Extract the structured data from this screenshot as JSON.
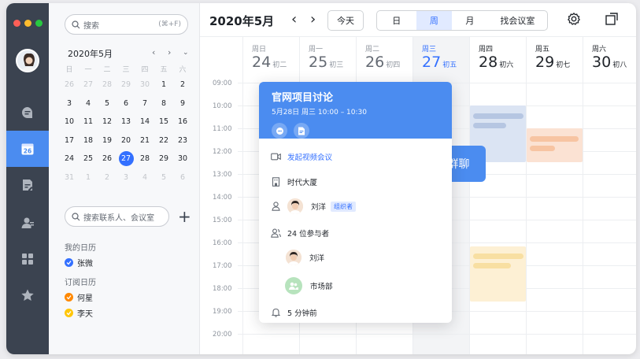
{
  "colors": {
    "accent": "#3370ff",
    "nav_bg": "#3b4350",
    "card_header": "#4b8cf0",
    "event_blue": "#dbe4f3",
    "event_orange": "#fbe2d3",
    "event_yellow": "#fdf0d4",
    "calendar_blue": "#3370ff",
    "calendar_orange": "#ff8800",
    "calendar_yellow": "#ffc60a"
  },
  "nav": {
    "items": [
      "chat-icon",
      "calendar-icon",
      "docs-icon",
      "contacts-icon",
      "apps-icon",
      "favorites-icon"
    ],
    "calendar_badge": "26"
  },
  "sidebar": {
    "search_placeholder": "搜索",
    "search_shortcut": "(⌘+F)",
    "mini_calendar": {
      "title": "2020年5月",
      "weekdays": [
        "日",
        "一",
        "二",
        "三",
        "四",
        "五",
        "六"
      ],
      "weeks": [
        [
          "26",
          "27",
          "28",
          "29",
          "30",
          "1",
          "2"
        ],
        [
          "3",
          "4",
          "5",
          "6",
          "7",
          "8",
          "9"
        ],
        [
          "10",
          "11",
          "12",
          "13",
          "14",
          "15",
          "16"
        ],
        [
          "17",
          "18",
          "19",
          "20",
          "21",
          "22",
          "23"
        ],
        [
          "24",
          "25",
          "26",
          "27",
          "28",
          "29",
          "30"
        ],
        [
          "31",
          "1",
          "2",
          "3",
          "4",
          "5",
          "6"
        ]
      ],
      "selected": "27"
    },
    "contacts_search_placeholder": "搜索联系人、会议室",
    "my_calendars_label": "我的日历",
    "my_calendars": [
      "张微"
    ],
    "subscribed_label": "订阅日历",
    "subscribed": [
      "何星",
      "李天"
    ]
  },
  "header": {
    "title": "2020年5月",
    "today": "今天",
    "views": [
      "日",
      "周",
      "月",
      "找会议室"
    ],
    "active_view": "周"
  },
  "week": {
    "days": [
      {
        "weekday": "周日",
        "date": "24",
        "lunar": "初二"
      },
      {
        "weekday": "周一",
        "date": "25",
        "lunar": "初三"
      },
      {
        "weekday": "周二",
        "date": "26",
        "lunar": "初四"
      },
      {
        "weekday": "周三",
        "date": "27",
        "lunar": "初五"
      },
      {
        "weekday": "周四",
        "date": "28",
        "lunar": "初六"
      },
      {
        "weekday": "周五",
        "date": "29",
        "lunar": "初七"
      },
      {
        "weekday": "周六",
        "date": "30",
        "lunar": "初八"
      }
    ],
    "times": [
      "09:00",
      "10:00",
      "11:00",
      "12:00",
      "13:00",
      "14:00",
      "15:00",
      "16:00",
      "17:00",
      "18:00",
      "19:00",
      "20:00"
    ]
  },
  "event_card": {
    "title": "官网项目讨论",
    "time": "5月28日 周三 10:00 – 10:30",
    "video": "发起视频会议",
    "location": "时代大厦",
    "organizer": "刘洋",
    "organizer_tag": "组织者",
    "attendees_count": "24 位参与者",
    "attendee_1": "刘洋",
    "attendee_2": "市场部",
    "reminder": "5 分钟前"
  },
  "tooltip": "一键开启会议群聊"
}
